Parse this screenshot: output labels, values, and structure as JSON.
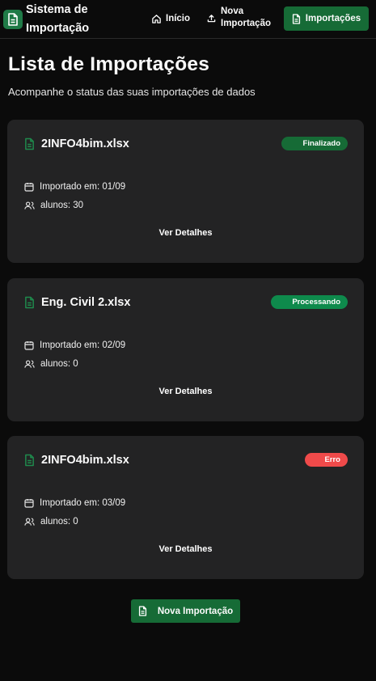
{
  "app": {
    "title": "Sistema de Importação"
  },
  "nav": {
    "home_label": "Início",
    "new_import_label": "Nova Importação",
    "imports_label": "Importações"
  },
  "page": {
    "title": "Lista de Importações",
    "subtitle": "Acompanhe o status das suas importações de dados"
  },
  "imports": [
    {
      "file": "2INFO4bim.xlsx",
      "status": "Finalizado",
      "status_color": "#166b36",
      "imported": "Importado em: 01/09",
      "students": "alunos: 30",
      "details": "Ver Detalhes"
    },
    {
      "file": "Eng. Civil 2.xlsx",
      "status": "Processando",
      "status_color": "#0e8a4c",
      "imported": "Importado em: 02/09",
      "students": "alunos: 0",
      "details": "Ver Detalhes"
    },
    {
      "file": "2INFO4bim.xlsx",
      "status": "Erro",
      "status_color": "#ef4a4a",
      "imported": "Importado em: 03/09",
      "students": "alunos: 0",
      "details": "Ver Detalhes"
    }
  ],
  "footer": {
    "new_import_button": "Nova Importação"
  },
  "colors": {
    "accent": "#166b36",
    "icon_green": "#1f8a4c",
    "card_bg": "#232324"
  }
}
